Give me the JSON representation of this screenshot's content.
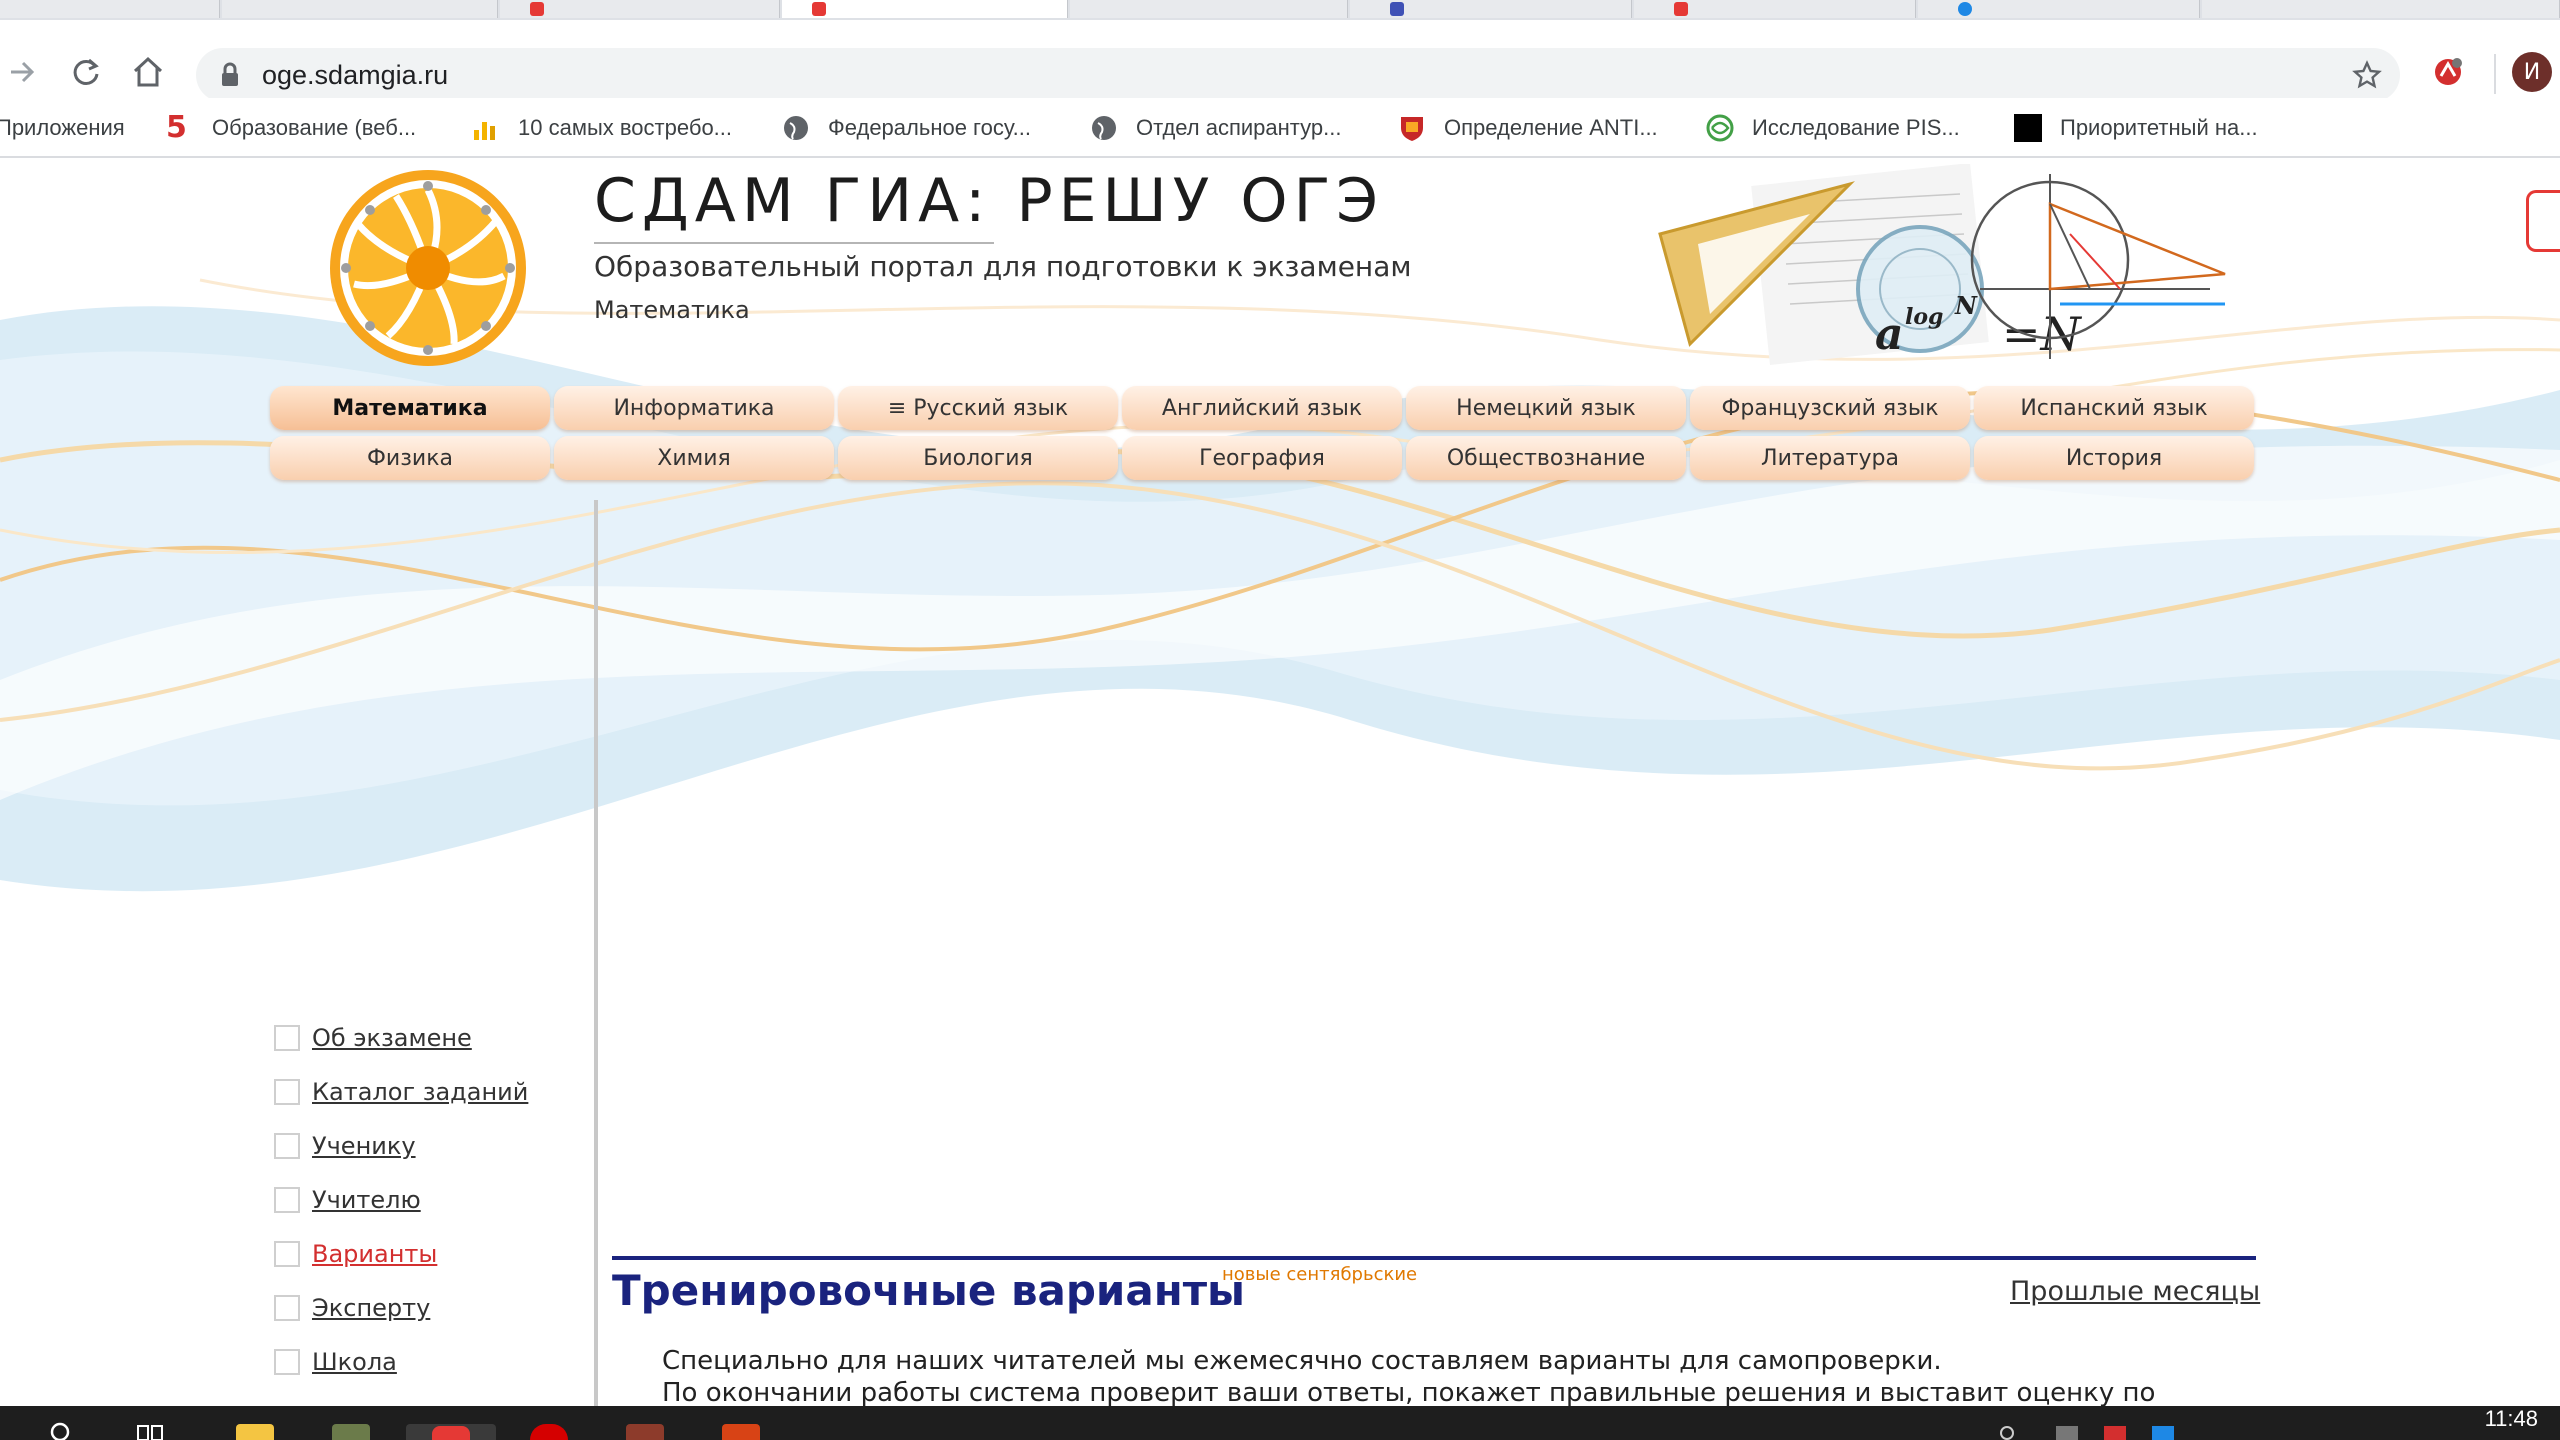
{
  "browser": {
    "url": "oge.sdamgia.ru",
    "bookmarks": [
      {
        "label": "Приложения",
        "icon": "apps-grid-icon"
      },
      {
        "label": "Образование (веб...",
        "icon": "red-s-icon"
      },
      {
        "label": "10 самых востребо...",
        "icon": "chart-icon"
      },
      {
        "label": "Федеральное госу...",
        "icon": "globe-icon"
      },
      {
        "label": "Отдел аспирантур...",
        "icon": "globe-icon"
      },
      {
        "label": "Определение ANTI...",
        "icon": "shield-crest-icon"
      },
      {
        "label": "Исследование PIS...",
        "icon": "green-swirl-icon"
      },
      {
        "label": "Приоритетный на...",
        "icon": "black-square-icon"
      }
    ],
    "profile_initial": "И"
  },
  "site": {
    "title": "СДАМ ГИА: РЕШУ ОГЭ",
    "subtitle": "Образовательный портал для подготовки к экзаменам",
    "subject": "Математика"
  },
  "subjects_row1": [
    "Математика",
    "Информатика",
    "≡ Русский язык",
    "Английский язык",
    "Немецкий язык",
    "Французский язык",
    "Испанский язык"
  ],
  "subjects_row2": [
    "Физика",
    "Химия",
    "Биология",
    "География",
    "Обществознание",
    "Литература",
    "История"
  ],
  "active_subject": "Математика",
  "side_menu": [
    {
      "label": "Об экзамене",
      "current": false
    },
    {
      "label": "Каталог заданий",
      "current": false
    },
    {
      "label": "Ученику",
      "current": false
    },
    {
      "label": "Учителю",
      "current": false
    },
    {
      "label": "Варианты",
      "current": true
    },
    {
      "label": "Эксперту",
      "current": false
    },
    {
      "label": "Школа",
      "current": false
    }
  ],
  "main": {
    "heading": "Тренировочные варианты",
    "badge": "новые сентябрьские",
    "past_link": "Прошлые месяцы",
    "intro_line1": "Специально для наших читателей мы ежемесячно составляем варианты для самопроверки.",
    "intro_line2": "По окончании работы система проверит ваши ответы, покажет правильные решения и выставит оценку по"
  },
  "taskbar": {
    "time": "11:48"
  },
  "colors": {
    "heading": "#1a237e",
    "current_menu": "#d32f2f",
    "badge": "#e07800",
    "tab_gradient_top": "#fff1e6",
    "tab_gradient_bottom": "#f9cfae"
  }
}
